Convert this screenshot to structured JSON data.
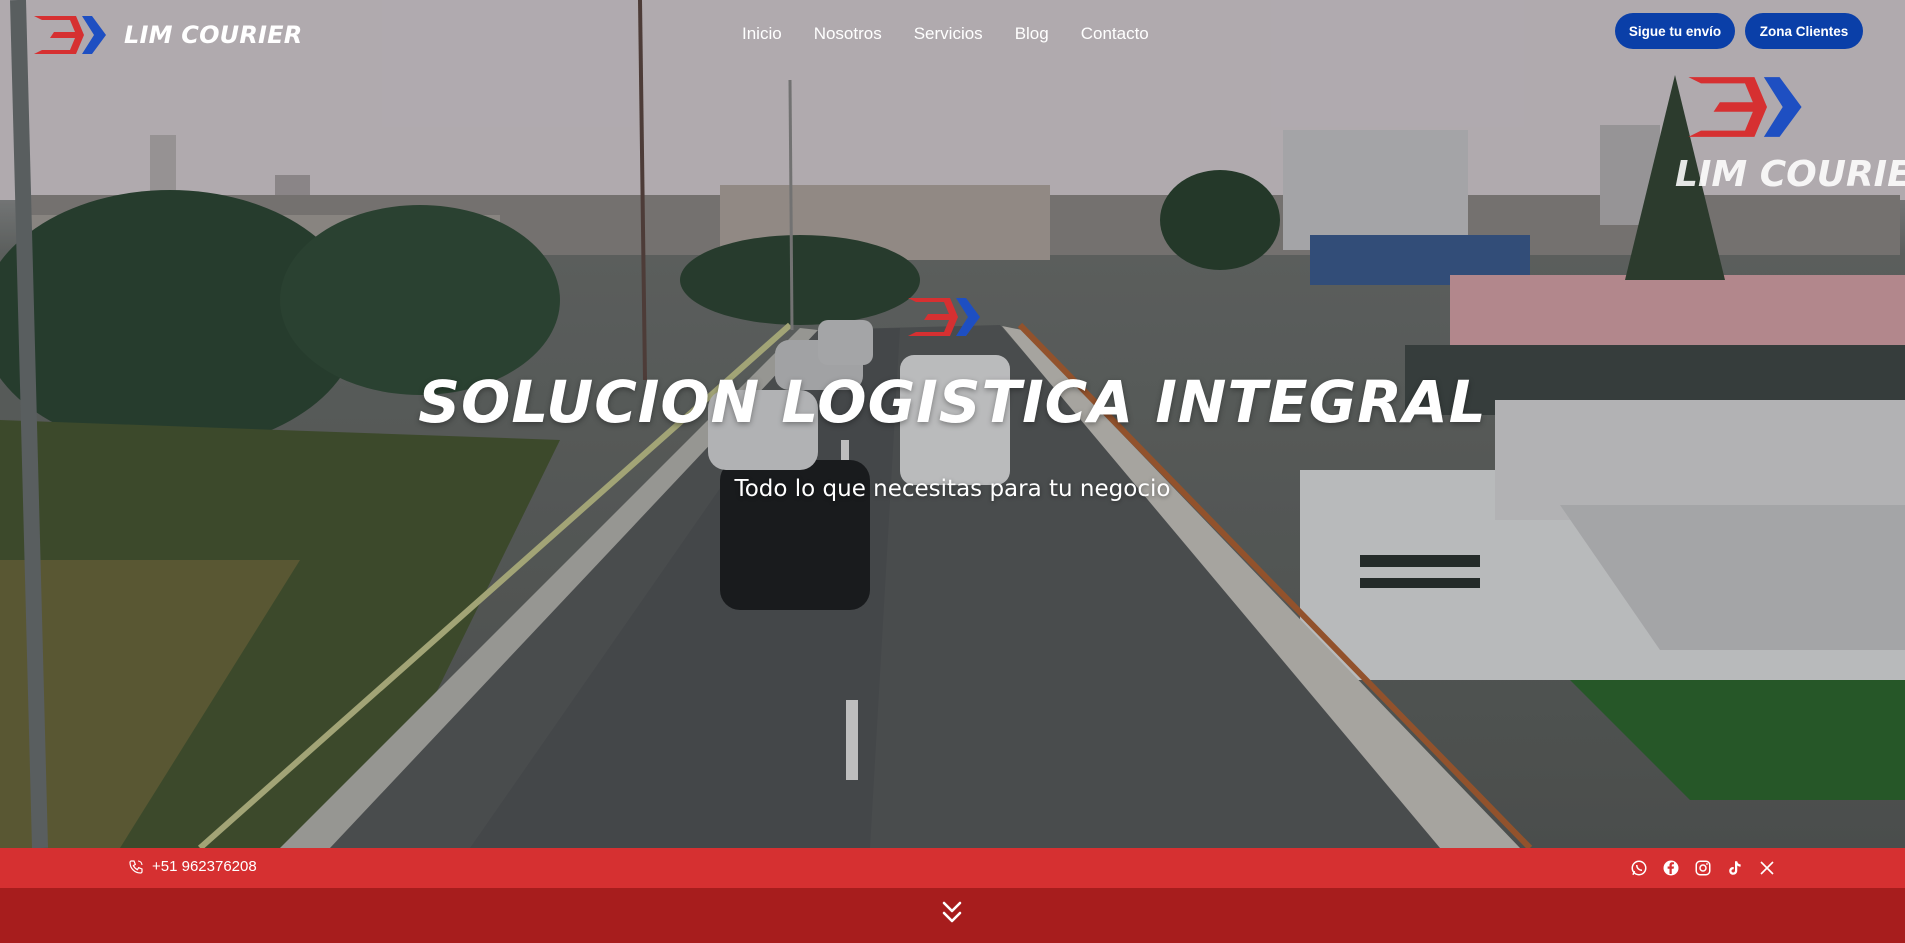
{
  "brand": {
    "name": "LIM COURIER",
    "watermark": "LIM COURIER"
  },
  "nav": [
    "Inicio",
    "Nosotros",
    "Servicios",
    "Blog",
    "Contacto"
  ],
  "buttons": {
    "track": "Sigue tu envío",
    "clients": "Zona Clientes"
  },
  "hero": {
    "title": "SOLUCION LOGISTICA INTEGRAL",
    "subtitle": "Todo lo que necesitas para tu negocio"
  },
  "contact": {
    "phone": "+51 962376208"
  },
  "social_icons": [
    "whatsapp-icon",
    "facebook-icon",
    "instagram-icon",
    "tiktok-icon",
    "x-icon"
  ],
  "colors": {
    "brand_red": "#d63031",
    "brand_blue": "#0a3fa8",
    "bar_dark": "#a71d1d"
  }
}
